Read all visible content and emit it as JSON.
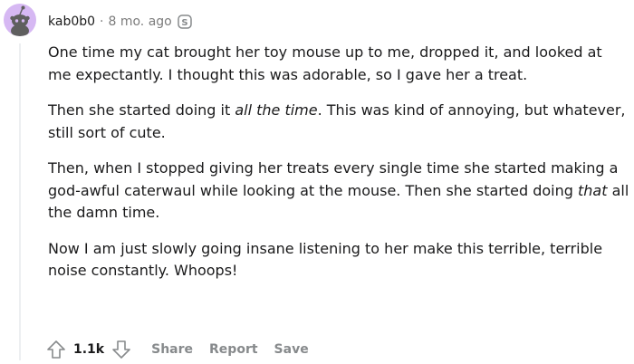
{
  "comment": {
    "username": "kab0b0",
    "separator": "·",
    "timestamp": "8 mo. ago",
    "edited_icon": "edited-s-icon",
    "avatar_icon": "snoo-avatar-icon",
    "paragraphs": [
      {
        "before": "One time my cat brought her toy mouse up to me, dropped it, and looked at me expectantly. I thought this was adorable, so I gave her a treat.",
        "em": "",
        "after": ""
      },
      {
        "before": "Then she started doing it ",
        "em": "all the time",
        "after": ". This was kind of annoying, but whatever, still sort of cute."
      },
      {
        "before": "Then, when I stopped giving her treats every single time she started making a god-awful caterwaul while looking at the mouse. Then she started doing ",
        "em": "that",
        "after": " all the damn time."
      },
      {
        "before": "Now I am just slowly going insane listening to her make this terrible, terrible noise constantly. Whoops!",
        "em": "",
        "after": ""
      }
    ],
    "actions": {
      "upvote_icon": "upvote-arrow-icon",
      "score": "1.1k",
      "downvote_icon": "downvote-arrow-icon",
      "share_label": "Share",
      "report_label": "Report",
      "save_label": "Save"
    },
    "colors": {
      "avatar_bg": "#d6b8f3",
      "meta_gray": "#7c7c7c",
      "action_gray": "#878a8c",
      "text": "#1a1a1b"
    }
  }
}
